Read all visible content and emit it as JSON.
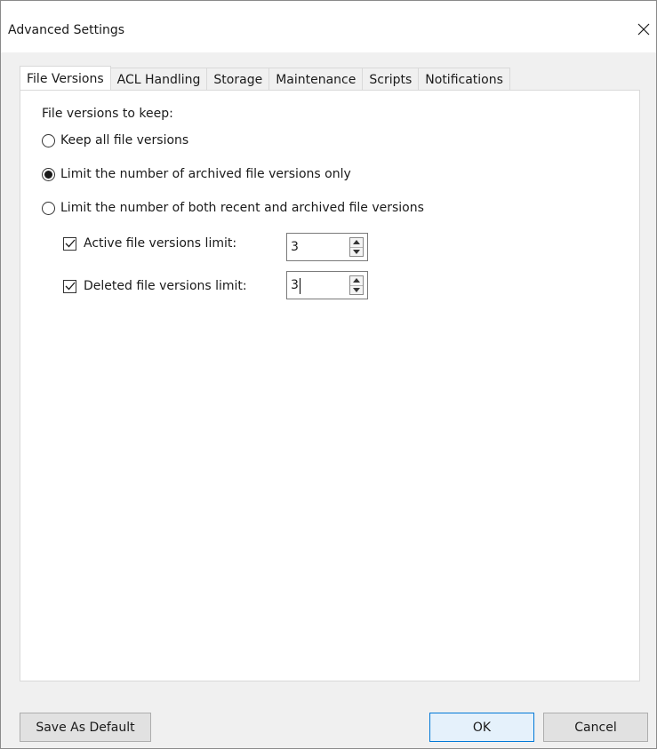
{
  "window": {
    "title": "Advanced Settings"
  },
  "tabs": [
    {
      "label": "File Versions",
      "active": true
    },
    {
      "label": "ACL Handling",
      "active": false
    },
    {
      "label": "Storage",
      "active": false
    },
    {
      "label": "Maintenance",
      "active": false
    },
    {
      "label": "Scripts",
      "active": false
    },
    {
      "label": "Notifications",
      "active": false
    }
  ],
  "file_versions": {
    "group_label": "File versions to keep:",
    "options": [
      {
        "label": "Keep all file versions",
        "selected": false
      },
      {
        "label": "Limit the number of archived file versions only",
        "selected": true
      },
      {
        "label": "Limit the number of both recent and archived file versions",
        "selected": false
      }
    ],
    "limits": [
      {
        "label": "Active file versions limit:",
        "checked": true,
        "value": "3"
      },
      {
        "label": "Deleted file versions limit:",
        "checked": true,
        "value": "3"
      }
    ]
  },
  "footer": {
    "save_default_label": "Save As Default",
    "ok_label": "OK",
    "cancel_label": "Cancel"
  }
}
